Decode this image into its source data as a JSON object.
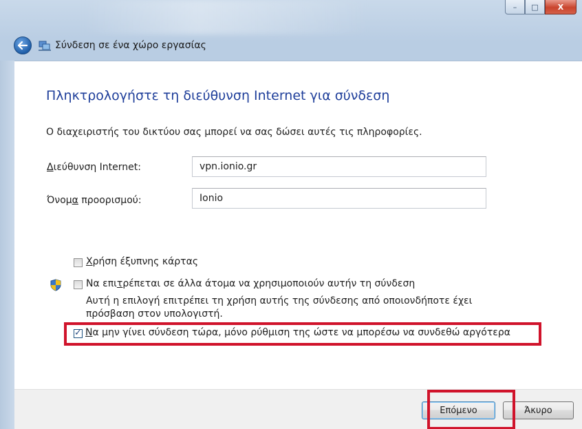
{
  "window": {
    "title": "Σύνδεση σε ένα χώρο εργασίας",
    "caption_buttons": {
      "minimize": "–",
      "maximize": "□",
      "close": "X"
    }
  },
  "page": {
    "heading": "Πληκτρολογήστε τη διεύθυνση Internet για σύνδεση",
    "description": "Ο διαχειριστής του δικτύου σας μπορεί να σας δώσει αυτές τις πληροφορίες."
  },
  "form": {
    "internet_address": {
      "label_prefix": "",
      "label_ul": "Δ",
      "label_rest": "ιεύθυνση Internet:",
      "value": "vpn.ionio.gr"
    },
    "destination_name": {
      "label_prefix": "Όνομ",
      "label_ul": "α",
      "label_rest": " προορισμού:",
      "value": "Ionio"
    }
  },
  "options": {
    "smart_card": {
      "label_ul": "Χ",
      "label_rest": "ρήση έξυπνης κάρτας",
      "checked": false
    },
    "allow_others": {
      "label_prefix": "Να επι",
      "label_ul": "τ",
      "label_rest": "ρέπεται σε άλλα άτομα να χρησιμοποιούν αυτήν τη σύνδεση",
      "checked": false,
      "note": "Αυτή η επιλογή επιτρέπει τη χρήση αυτής της σύνδεσης από οποιονδήποτε έχει πρόσβαση στον υπολογιστή."
    },
    "dont_connect": {
      "label_ul": "Ν",
      "label_rest": "α μην γίνει σύνδεση τώρα, μόνο ρύθμιση της ώστε να μπορέσω να συνδεθώ αργότερα",
      "checked": true
    }
  },
  "buttons": {
    "next": "Επόμενο",
    "cancel": "Άκυρο"
  },
  "colors": {
    "heading": "#1e3e9a",
    "highlight": "#d0132b"
  }
}
